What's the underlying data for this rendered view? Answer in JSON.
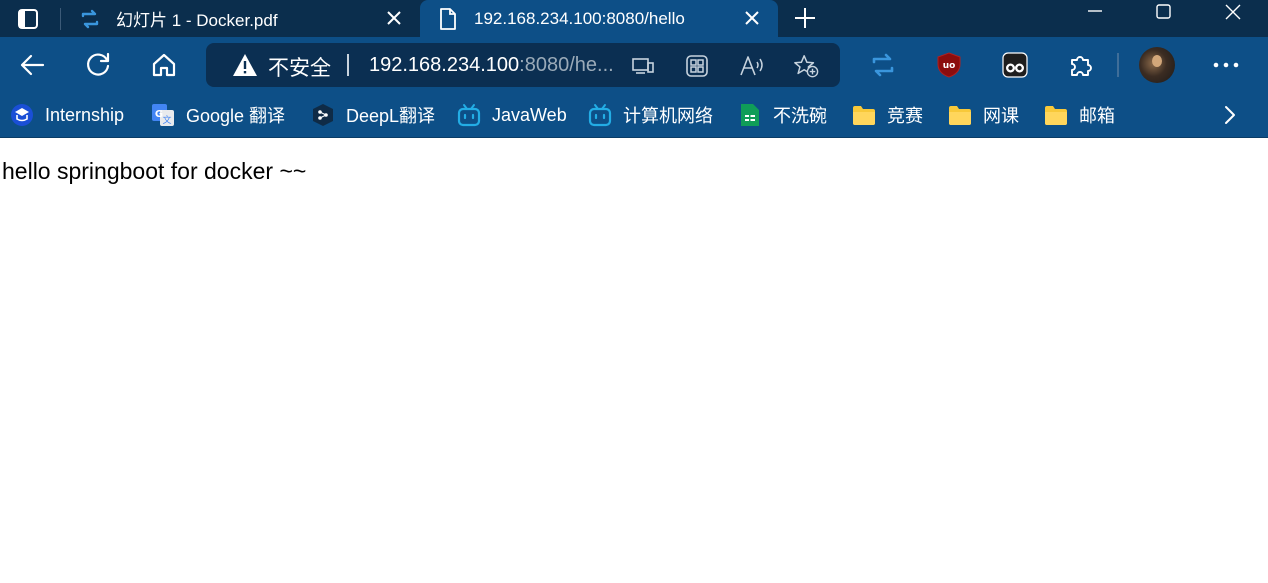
{
  "tabs": [
    {
      "title": "幻灯片 1 - Docker.pdf",
      "active": false,
      "favicon": "pdf-sync-icon"
    },
    {
      "title": "192.168.234.100:8080/hello",
      "active": true,
      "favicon": "page-icon"
    }
  ],
  "omnibox": {
    "security_label": "不安全",
    "url_host": "192.168.234.100",
    "url_path": ":8080/he..."
  },
  "bookmarks": [
    {
      "label": "Internship",
      "icon": "internship-icon"
    },
    {
      "label": "Google 翻译",
      "icon": "google-translate-icon"
    },
    {
      "label": "DeepL翻译",
      "icon": "deepl-icon"
    },
    {
      "label": "JavaWeb",
      "icon": "bilibili-icon"
    },
    {
      "label": "计算机网络",
      "icon": "bilibili-icon"
    },
    {
      "label": "不洗碗",
      "icon": "sheets-icon"
    },
    {
      "label": "竞赛",
      "icon": "folder-icon"
    },
    {
      "label": "网课",
      "icon": "folder-icon"
    },
    {
      "label": "邮箱",
      "icon": "folder-icon"
    }
  ],
  "page": {
    "text": "hello springboot for docker ~~"
  },
  "colors": {
    "tabstrip": "#0b2e4d",
    "toolbar": "#0d4f87",
    "omnibox": "#0b2f52",
    "accent_blue": "#3a96dd"
  }
}
